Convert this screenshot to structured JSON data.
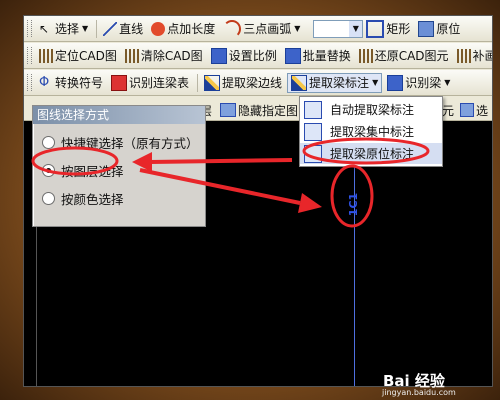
{
  "toolbar1": {
    "select": "选择",
    "line": "直线",
    "point_length": "点加长度",
    "arc": "三点画弧",
    "rect": "矩形",
    "origin": "原位"
  },
  "toolbar2": {
    "locate_cad": "定位CAD图",
    "clear_cad": "清除CAD图",
    "set_scale": "设置比例",
    "batch_replace": "批量替换",
    "restore_cad": "还原CAD图元",
    "patch": "补画"
  },
  "toolbar3": {
    "convert_symbol": "转换符号",
    "identify_beam_table": "识别连梁表",
    "extract_beam_edge": "提取梁边线",
    "extract_beam_label": "提取梁标注",
    "identify_beam": "识别梁"
  },
  "row4": {
    "layer": "层",
    "hide_specified": "隐藏指定图",
    "yuan": "元",
    "select": "选"
  },
  "panel": {
    "title": "图线选择方式",
    "options": [
      "快捷键选择（原有方式）",
      "按图层选择",
      "按颜色选择"
    ],
    "selected_index": 1
  },
  "dropdown": {
    "items": [
      "自动提取梁标注",
      "提取梁集中标注",
      "提取梁原位标注"
    ],
    "highlighted_index": 2
  },
  "canvas": {
    "label": "1C1"
  },
  "watermark": {
    "brand": "Bai 经验",
    "url": "jingyan.baidu.com"
  },
  "colors": {
    "annotation_red": "#e8262a",
    "canvas_blue": "#2f53e8"
  }
}
